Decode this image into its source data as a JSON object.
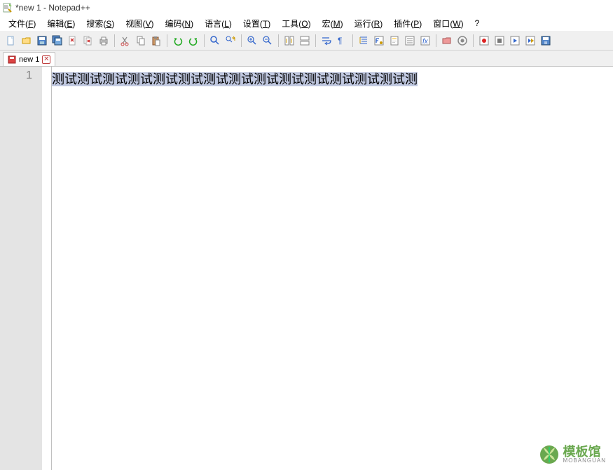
{
  "title": "*new 1 - Notepad++",
  "menu": {
    "file": {
      "label": "文件",
      "key": "F"
    },
    "edit": {
      "label": "编辑",
      "key": "E"
    },
    "search": {
      "label": "搜索",
      "key": "S"
    },
    "view": {
      "label": "视图",
      "key": "V"
    },
    "encoding": {
      "label": "编码",
      "key": "N"
    },
    "language": {
      "label": "语言",
      "key": "L"
    },
    "settings": {
      "label": "设置",
      "key": "T"
    },
    "tools": {
      "label": "工具",
      "key": "O"
    },
    "macro": {
      "label": "宏",
      "key": "M"
    },
    "run": {
      "label": "运行",
      "key": "R"
    },
    "plugins": {
      "label": "插件",
      "key": "P"
    },
    "window": {
      "label": "窗口",
      "key": "W"
    },
    "help": {
      "label": "?"
    }
  },
  "tab": {
    "label": "new 1"
  },
  "gutter": {
    "line1": "1"
  },
  "content": {
    "line1": "测试测试测试测试测试测试测试测试测试测试测试测试测试测试测"
  },
  "watermark": {
    "cn": "模板馆",
    "en": "MOBANGUAN"
  }
}
